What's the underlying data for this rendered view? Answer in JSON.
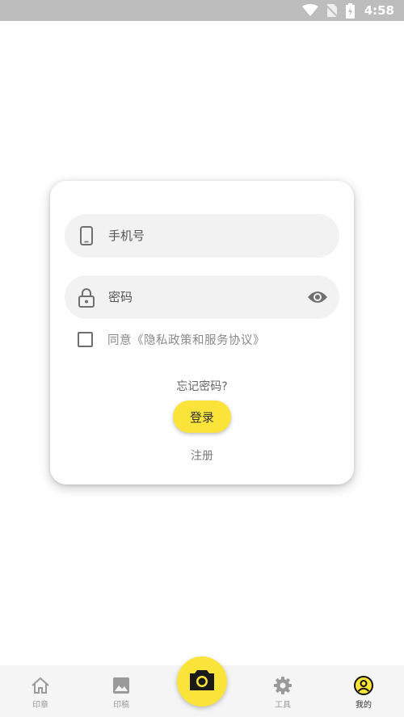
{
  "status_bar": {
    "time": "4:58",
    "icons": [
      "wifi-icon",
      "no-sim-icon",
      "battery-charging-icon"
    ]
  },
  "login": {
    "phone_placeholder": "手机号",
    "password_placeholder": "密码",
    "agree_text": "同意《隐私政策和服务协议》",
    "agree_checked": false,
    "forgot_password": "忘记密码?",
    "login_button": "登录",
    "register_link": "注册"
  },
  "bottom_nav": {
    "items": [
      {
        "label": "印章",
        "icon": "home-icon",
        "active": false
      },
      {
        "label": "印稿",
        "icon": "image-icon",
        "active": false
      },
      {
        "label": "工具",
        "icon": "gear-icon",
        "active": false
      },
      {
        "label": "我的",
        "icon": "profile-icon",
        "active": true
      }
    ],
    "center_icon": "camera-icon"
  },
  "colors": {
    "accent": "#fbe43a",
    "status_bar": "#bdbdbd",
    "field_bg": "#f2f2f2"
  }
}
